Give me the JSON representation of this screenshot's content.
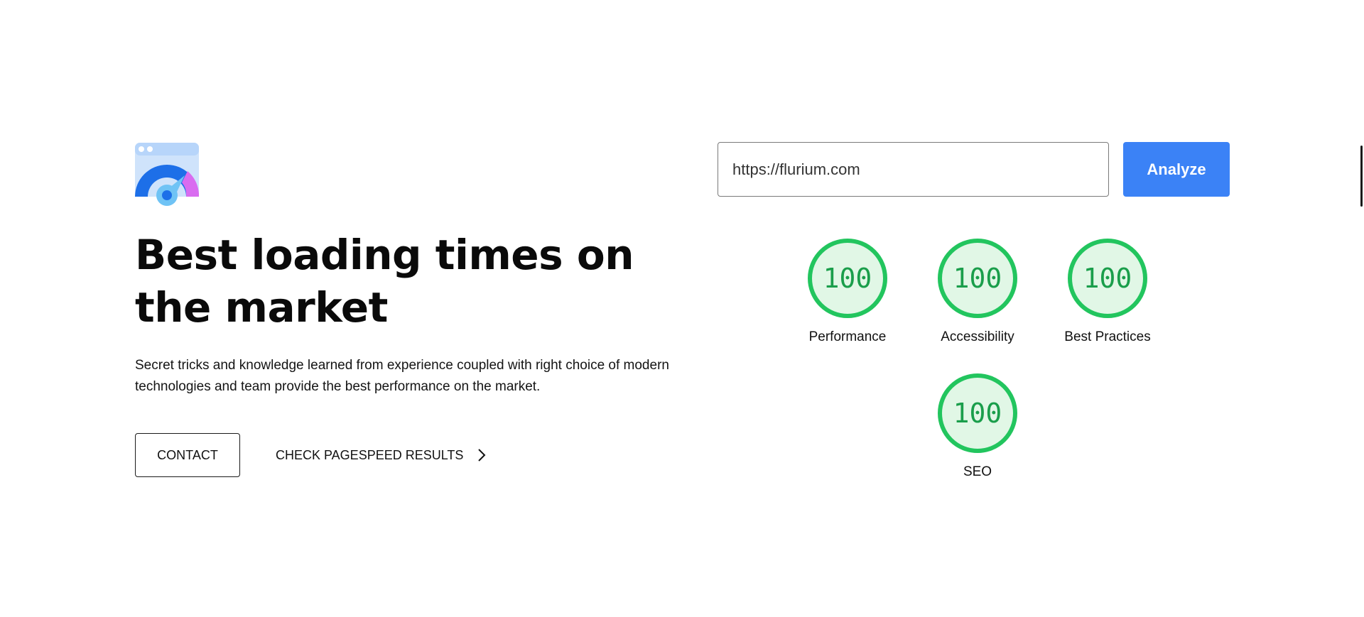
{
  "hero": {
    "logo_icon": "speedometer-browser-icon",
    "headline": "Best loading times on the market",
    "lead": "Secret tricks and knowledge learned from experience coupled with right choice of modern technologies and team provide the best performance on the market.",
    "contact_label": "CONTACT",
    "pagespeed_label": "CHECK PAGESPEED RESULTS",
    "pagespeed_icon": "chevron-right-icon"
  },
  "analyzer": {
    "url_value": "https://flurium.com",
    "analyze_label": "Analyze",
    "accent_color": "#3b82f6"
  },
  "scores": {
    "color_good": "#22c55e",
    "items": [
      {
        "value": "100",
        "label": "Performance"
      },
      {
        "value": "100",
        "label": "Accessibility"
      },
      {
        "value": "100",
        "label": "Best Practices"
      },
      {
        "value": "100",
        "label": "SEO"
      }
    ]
  }
}
